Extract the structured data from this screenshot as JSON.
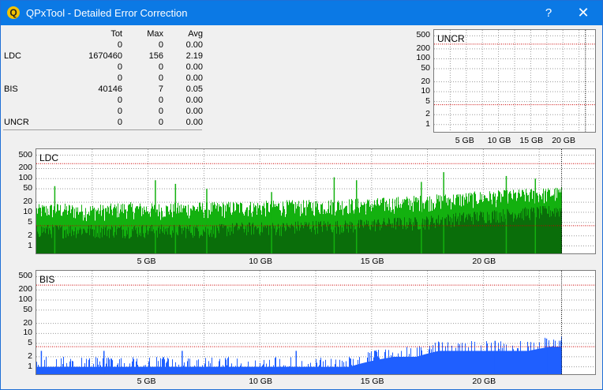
{
  "window": {
    "title": "QPxTool - Detailed Error Correction",
    "help_label": "?",
    "close_label": "✕",
    "app_icon_letter": "Q"
  },
  "stats": {
    "headers": {
      "tot": "Tot",
      "max": "Max",
      "avg": "Avg"
    },
    "rows": [
      {
        "name": "",
        "tot": "0",
        "max": "0",
        "avg": "0.00"
      },
      {
        "name": "LDC",
        "tot": "1670460",
        "max": "156",
        "avg": "2.19"
      },
      {
        "name": "",
        "tot": "0",
        "max": "0",
        "avg": "0.00"
      },
      {
        "name": "",
        "tot": "0",
        "max": "0",
        "avg": "0.00"
      },
      {
        "name": "BIS",
        "tot": "40146",
        "max": "7",
        "avg": "0.05"
      },
      {
        "name": "",
        "tot": "0",
        "max": "0",
        "avg": "0.00"
      },
      {
        "name": "",
        "tot": "0",
        "max": "0",
        "avg": "0.00"
      },
      {
        "name": "UNCR",
        "tot": "0",
        "max": "0",
        "avg": "0.00"
      }
    ]
  },
  "chart_data": [
    {
      "type": "bar",
      "title": "UNCR",
      "scale": "log",
      "y_ticks": [
        "500",
        "200",
        "100",
        "50",
        "20",
        "10",
        "5",
        "2",
        "1"
      ],
      "x_ticks": [
        "5 GB",
        "10 GB",
        "15 GB",
        "20 GB"
      ],
      "x_tick_values_gb": [
        5,
        10,
        15,
        20
      ],
      "x_range_gb": [
        0,
        25
      ],
      "y_range": [
        0.6,
        750
      ],
      "disc_end_gb": 23.5,
      "series": [
        {
          "color": "#000000",
          "values": []
        }
      ],
      "threshold_lines": [
        {
          "value": 4,
          "color": "#cc0000"
        },
        {
          "value": 280,
          "color": "#cc0000"
        }
      ],
      "grid": true
    },
    {
      "type": "bar",
      "title": "LDC",
      "scale": "log",
      "y_ticks": [
        "500",
        "200",
        "100",
        "50",
        "20",
        "10",
        "5",
        "2",
        "1"
      ],
      "x_ticks": [
        "5 GB",
        "10 GB",
        "15 GB",
        "20 GB"
      ],
      "x_tick_values_gb": [
        5,
        10,
        15,
        20
      ],
      "x_range_gb": [
        0,
        25
      ],
      "y_range": [
        0.6,
        750
      ],
      "disc_end_gb": 23.5,
      "series": [
        {
          "color": "#13b10f",
          "x_gb": [
            0,
            1,
            2,
            3,
            4,
            5,
            6,
            7,
            8,
            9,
            10,
            11,
            12,
            13,
            14,
            15,
            16,
            17,
            18,
            19,
            20,
            21,
            22,
            23,
            23.5
          ],
          "values": [
            12,
            13,
            12,
            12,
            14,
            13,
            13,
            14,
            14,
            15,
            15,
            16,
            16,
            17,
            18,
            18,
            20,
            22,
            24,
            27,
            30,
            32,
            35,
            38,
            40
          ]
        },
        {
          "color": "#0a6e0a",
          "x_gb": [
            0,
            1,
            2,
            3,
            4,
            5,
            6,
            7,
            8,
            9,
            10,
            11,
            12,
            13,
            14,
            15,
            16,
            17,
            18,
            19,
            20,
            21,
            22,
            23,
            23.5
          ],
          "values": [
            3,
            3,
            3,
            3,
            3,
            3,
            3,
            3,
            3,
            3.5,
            3.5,
            3.5,
            4,
            4,
            4,
            4.5,
            5,
            5,
            6,
            7,
            8,
            9,
            10,
            11,
            12
          ]
        }
      ],
      "spikes": [
        {
          "x_gb": 0.8,
          "value": 60
        },
        {
          "x_gb": 5.3,
          "value": 90
        },
        {
          "x_gb": 6.2,
          "value": 70
        },
        {
          "x_gb": 7.6,
          "value": 50
        },
        {
          "x_gb": 10.5,
          "value": 40
        },
        {
          "x_gb": 13.3,
          "value": 110
        },
        {
          "x_gb": 14.3,
          "value": 90
        },
        {
          "x_gb": 17.2,
          "value": 80
        },
        {
          "x_gb": 18.2,
          "value": 156
        },
        {
          "x_gb": 21.0,
          "value": 120
        },
        {
          "x_gb": 22.3,
          "value": 100
        }
      ],
      "threshold_lines": [
        {
          "value": 4,
          "color": "#cc0000"
        },
        {
          "value": 280,
          "color": "#cc0000"
        }
      ],
      "grid": true
    },
    {
      "type": "bar",
      "title": "BIS",
      "scale": "log",
      "y_ticks": [
        "500",
        "200",
        "100",
        "50",
        "20",
        "10",
        "5",
        "2",
        "1"
      ],
      "x_ticks": [
        "5 GB",
        "10 GB",
        "15 GB",
        "20 GB"
      ],
      "x_tick_values_gb": [
        5,
        10,
        15,
        20
      ],
      "x_range_gb": [
        0,
        25
      ],
      "y_range": [
        0.6,
        750
      ],
      "disc_end_gb": 23.5,
      "series": [
        {
          "color": "#1f5fff",
          "x_gb": [
            0,
            1,
            2,
            3,
            4,
            5,
            6,
            7,
            8,
            9,
            10,
            11,
            12,
            13,
            14,
            15,
            16,
            17,
            18,
            19,
            20,
            21,
            22,
            23,
            23.5
          ],
          "values": [
            1,
            1,
            1,
            1,
            1,
            1,
            1,
            1,
            1,
            1,
            1,
            1,
            1,
            1,
            1,
            1.5,
            2,
            2,
            3,
            3,
            3,
            3,
            3,
            4,
            4
          ]
        }
      ],
      "spikes": [
        {
          "x_gb": 0.2,
          "value": 3
        },
        {
          "x_gb": 3.0,
          "value": 3
        },
        {
          "x_gb": 6.5,
          "value": 3
        },
        {
          "x_gb": 11.6,
          "value": 3
        },
        {
          "x_gb": 20.5,
          "value": 6
        },
        {
          "x_gb": 22.8,
          "value": 7
        }
      ],
      "threshold_lines": [
        {
          "value": 4,
          "color": "#cc0000"
        },
        {
          "value": 280,
          "color": "#cc0000"
        }
      ],
      "grid": true
    }
  ]
}
